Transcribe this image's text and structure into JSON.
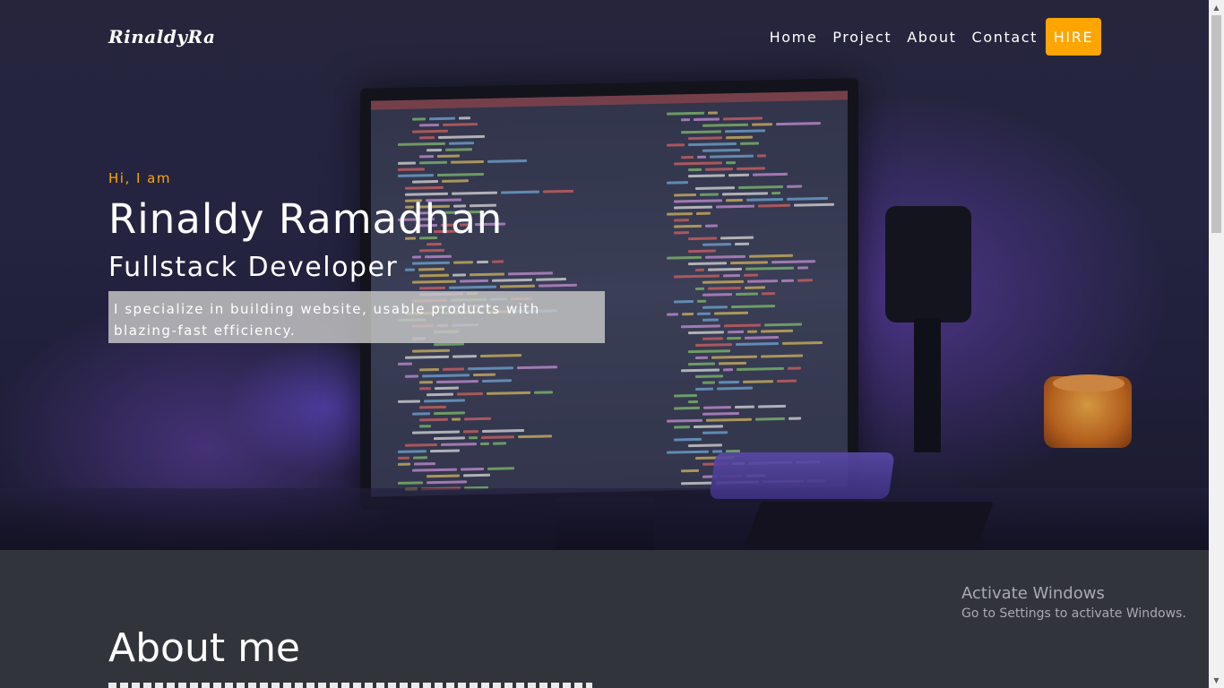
{
  "nav": {
    "logo": "RinaldyRa",
    "links": [
      "Home",
      "Project",
      "About",
      "Contact"
    ],
    "hire_label": "HIRE"
  },
  "hero": {
    "greeting": "Hi, I am",
    "name": "Rinaldy Ramadhan",
    "role": "Fullstack Developer",
    "intro": "I specialize in building website, usable products with blazing-fast efficiency."
  },
  "about": {
    "title": "About me"
  },
  "watermark": {
    "title": "Activate Windows",
    "subtitle": "Go to Settings to activate Windows."
  },
  "colors": {
    "accent": "#ffa500",
    "section_bg": "#32343c",
    "text": "#ffffff"
  }
}
